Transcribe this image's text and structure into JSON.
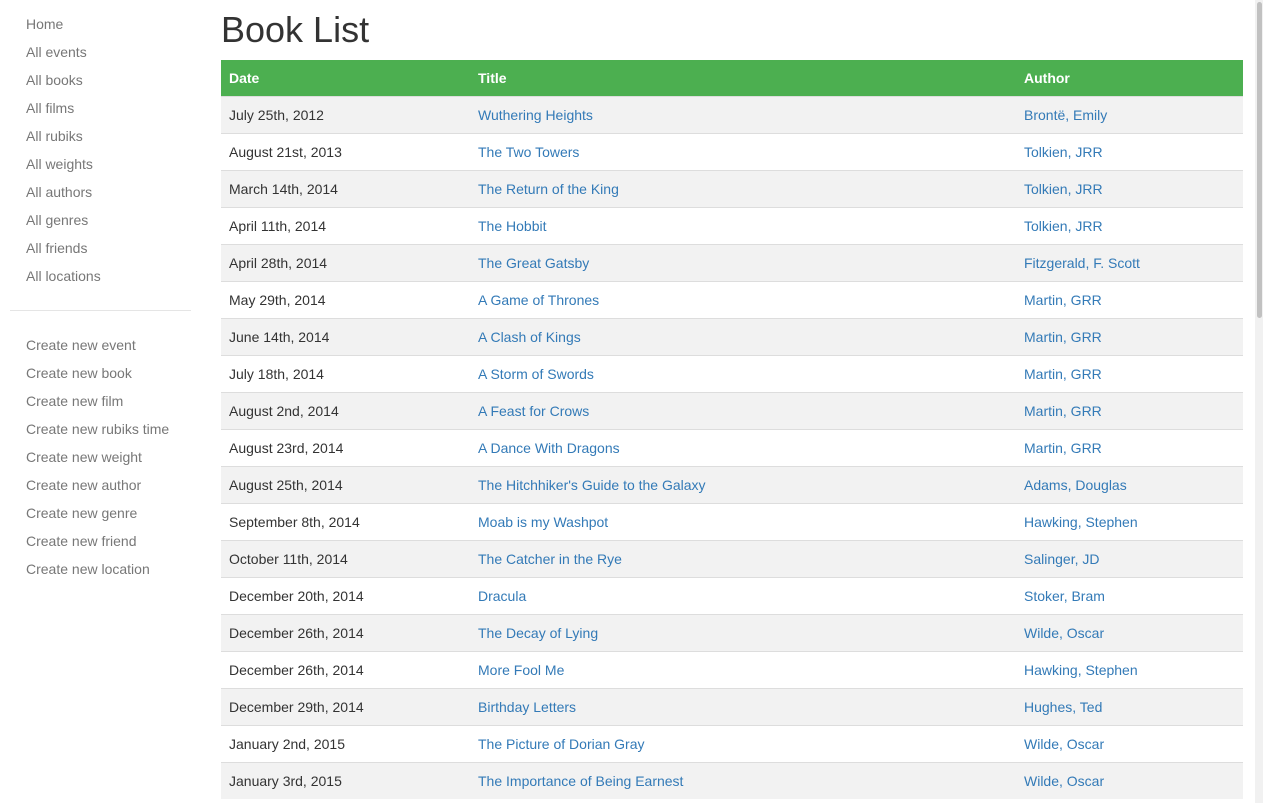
{
  "sidebar": {
    "list_links": [
      "Home",
      "All events",
      "All books",
      "All films",
      "All rubiks",
      "All weights",
      "All authors",
      "All genres",
      "All friends",
      "All locations"
    ],
    "create_links": [
      "Create new event",
      "Create new book",
      "Create new film",
      "Create new rubiks time",
      "Create new weight",
      "Create new author",
      "Create new genre",
      "Create new friend",
      "Create new location"
    ]
  },
  "main": {
    "title": "Book List",
    "columns": [
      "Date",
      "Title",
      "Author"
    ],
    "rows": [
      {
        "date": "July 25th, 2012",
        "title": "Wuthering Heights",
        "author": "Brontë, Emily"
      },
      {
        "date": "August 21st, 2013",
        "title": "The Two Towers",
        "author": "Tolkien, JRR"
      },
      {
        "date": "March 14th, 2014",
        "title": "The Return of the King",
        "author": "Tolkien, JRR"
      },
      {
        "date": "April 11th, 2014",
        "title": "The Hobbit",
        "author": "Tolkien, JRR"
      },
      {
        "date": "April 28th, 2014",
        "title": "The Great Gatsby",
        "author": "Fitzgerald, F. Scott"
      },
      {
        "date": "May 29th, 2014",
        "title": "A Game of Thrones",
        "author": "Martin, GRR"
      },
      {
        "date": "June 14th, 2014",
        "title": "A Clash of Kings",
        "author": "Martin, GRR"
      },
      {
        "date": "July 18th, 2014",
        "title": "A Storm of Swords",
        "author": "Martin, GRR"
      },
      {
        "date": "August 2nd, 2014",
        "title": "A Feast for Crows",
        "author": "Martin, GRR"
      },
      {
        "date": "August 23rd, 2014",
        "title": "A Dance With Dragons",
        "author": "Martin, GRR"
      },
      {
        "date": "August 25th, 2014",
        "title": "The Hitchhiker's Guide to the Galaxy",
        "author": "Adams, Douglas"
      },
      {
        "date": "September 8th, 2014",
        "title": "Moab is my Washpot",
        "author": "Hawking, Stephen"
      },
      {
        "date": "October 11th, 2014",
        "title": "The Catcher in the Rye",
        "author": "Salinger, JD"
      },
      {
        "date": "December 20th, 2014",
        "title": "Dracula",
        "author": "Stoker, Bram"
      },
      {
        "date": "December 26th, 2014",
        "title": "The Decay of Lying",
        "author": "Wilde, Oscar"
      },
      {
        "date": "December 26th, 2014",
        "title": "More Fool Me",
        "author": "Hawking, Stephen"
      },
      {
        "date": "December 29th, 2014",
        "title": "Birthday Letters",
        "author": "Hughes, Ted"
      },
      {
        "date": "January 2nd, 2015",
        "title": "The Picture of Dorian Gray",
        "author": "Wilde, Oscar"
      },
      {
        "date": "January 3rd, 2015",
        "title": "The Importance of Being Earnest",
        "author": "Wilde, Oscar"
      }
    ]
  },
  "colors": {
    "header_bg": "#4caf50",
    "link": "#337ab7",
    "nav_link": "#777777",
    "stripe": "#f2f2f2"
  }
}
